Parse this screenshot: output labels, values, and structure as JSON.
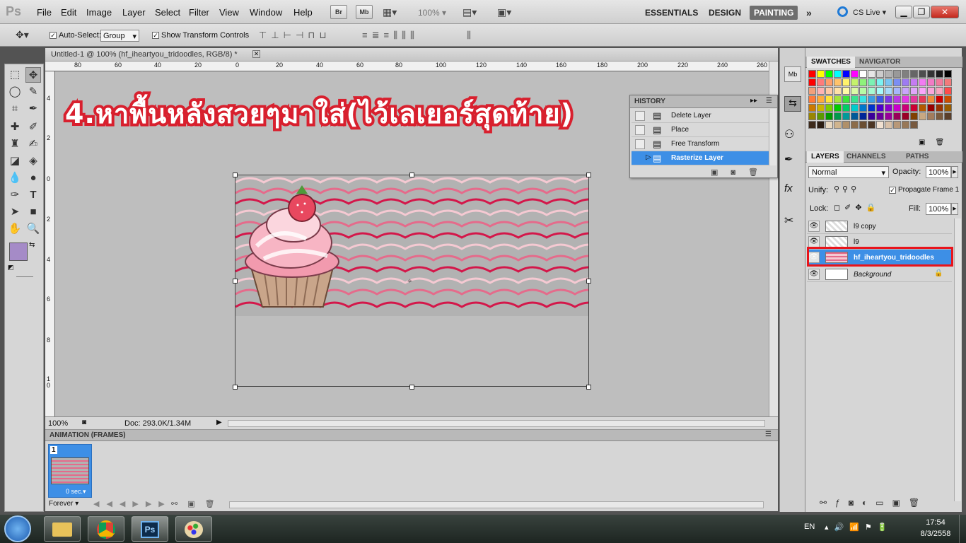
{
  "app": {
    "logo": "Ps",
    "menu": [
      "File",
      "Edit",
      "Image",
      "Layer",
      "Select",
      "Filter",
      "View",
      "Window",
      "Help"
    ],
    "bridge_button": "Br",
    "minibridge_button": "Mb",
    "zoom_dropdown": "100%",
    "workspaces": [
      "ESSENTIALS",
      "DESIGN",
      "PAINTING"
    ],
    "active_workspace": "PAINTING",
    "more_workspaces": "»",
    "cs_live": "CS Live"
  },
  "options": {
    "auto_select_label": "Auto-Select:",
    "auto_select_value": "Group",
    "show_transform_label": "Show Transform Controls"
  },
  "document": {
    "tab_title": "Untitled-1 @ 100% (hf_iheartyou_tridoodles, RGB/8) *",
    "annotation_text": "4.หาพื้นหลังสวยๆมาใส่(ไว้เลเยอร์สุดท้าย)",
    "ruler_h_ticks": [
      "80",
      "60",
      "40",
      "20",
      "0",
      "20",
      "40",
      "60",
      "80",
      "100",
      "120",
      "140",
      "160",
      "180",
      "200",
      "220",
      "240",
      "260"
    ],
    "ruler_v_ticks": [
      "4",
      "2",
      "0",
      "2",
      "4",
      "6",
      "8",
      "1 0"
    ],
    "status_zoom": "100%",
    "status_doc": "Doc: 293.0K/1.34M"
  },
  "history": {
    "title": "HISTORY",
    "items": [
      "Delete Layer",
      "Place",
      "Free Transform",
      "Rasterize Layer"
    ],
    "selected_index": 3
  },
  "swatches": {
    "tabs": [
      "SWATCHES",
      "NAVIGATOR"
    ],
    "colors": [
      "#ff0000",
      "#ffff00",
      "#00ff00",
      "#00ffff",
      "#0000ff",
      "#ff00ff",
      "#ffffff",
      "#e6e6e6",
      "#cccccc",
      "#b3b3b3",
      "#999999",
      "#808080",
      "#666666",
      "#4d4d4d",
      "#333333",
      "#1a1a1a",
      "#000000",
      "#ff0000",
      "#ff7b7b",
      "#ff9e6b",
      "#ffc36b",
      "#fff26b",
      "#c5f26b",
      "#8ef27b",
      "#7bf2b4",
      "#7bf2f2",
      "#7bc5f2",
      "#7b8ef2",
      "#9e7bf2",
      "#c57bf2",
      "#f27bf2",
      "#f27bc5",
      "#f27b9e",
      "#f27b7b",
      "#f2a07b",
      "#ffb3b3",
      "#ffc9a6",
      "#ffe0a6",
      "#fffaa6",
      "#dbfaa6",
      "#b6faa6",
      "#a6fad2",
      "#a6fafa",
      "#a6dbfa",
      "#a6b6fa",
      "#c9a6fa",
      "#e0a6fa",
      "#faa6fa",
      "#faa6db",
      "#faa6c0",
      "#ff4b4b",
      "#ff7a3b",
      "#ffab3b",
      "#ffe33b",
      "#a5e33b",
      "#3be33b",
      "#3be38f",
      "#3be3e3",
      "#3b9ee3",
      "#3b5be3",
      "#7a3be3",
      "#b93be3",
      "#e33be3",
      "#e33b9e",
      "#e33b5b",
      "#f08c3b",
      "#cc0000",
      "#cc4d00",
      "#cc7a00",
      "#ccb300",
      "#7acc00",
      "#00cc00",
      "#00cc66",
      "#00cccc",
      "#0077cc",
      "#0033cc",
      "#4d00cc",
      "#8c00cc",
      "#cc00cc",
      "#cc0077",
      "#cc0033",
      "#b35900",
      "#990000",
      "#993300",
      "#995c00",
      "#998600",
      "#5c9900",
      "#009900",
      "#00994d",
      "#009999",
      "#005999",
      "#002699",
      "#3a0099",
      "#690099",
      "#990099",
      "#990059",
      "#990026",
      "#804000",
      "#c8a882",
      "#a37c5c",
      "#7a5a3d",
      "#5a3f2a",
      "#3d2a1b",
      "#2b1d12",
      "#e8d8c0",
      "#d0b48e",
      "#b0906a",
      "#8c6c4a",
      "#6b4f33",
      "#4c3624",
      "#f0e0d0",
      "#d8c0a8",
      "#b89878",
      "#987858",
      "#785a40"
    ]
  },
  "layers": {
    "tabs": [
      "LAYERS",
      "CHANNELS",
      "PATHS"
    ],
    "blend_mode": "Normal",
    "opacity_label": "Opacity:",
    "opacity": "100%",
    "unify_label": "Unify:",
    "propagate_label": "Propagate Frame 1",
    "lock_label": "Lock:",
    "fill_label": "Fill:",
    "fill": "100%",
    "items": [
      {
        "name": "l9 copy"
      },
      {
        "name": "l9"
      },
      {
        "name": "hf_iheartyou_tridoodles"
      },
      {
        "name": "Background"
      }
    ],
    "selected_index": 2,
    "highlight_color": "#e8141b"
  },
  "animation": {
    "title": "ANIMATION (FRAMES)",
    "frame_number": "1",
    "frame_delay": "0 sec.",
    "loop": "Forever"
  },
  "taskbar": {
    "language": "EN",
    "time": "17:54",
    "date": "8/3/2558"
  },
  "colors": {
    "accent_blue": "#3d8fe6",
    "annotation_red": "#d8202e",
    "foreground_color": "#a58bc7"
  }
}
